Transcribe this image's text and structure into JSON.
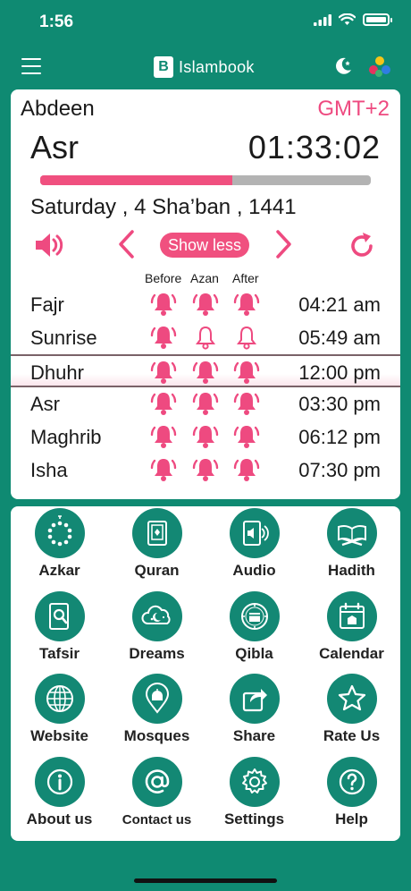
{
  "status": {
    "time": "1:56"
  },
  "nav": {
    "app_name": "Islambook",
    "logo_letter": "B"
  },
  "prayer_card": {
    "location": "Abdeen",
    "timezone": "GMT+2",
    "current_prayer": "Asr",
    "countdown": "01:33:02",
    "progress_fraction": 0.58,
    "date": "Saturday , 4 Sha’ban , 1441",
    "show_less_label": "Show less",
    "columns": {
      "before": "Before",
      "azan": "Azan",
      "after": "After"
    },
    "prayers": [
      {
        "name": "Fajr",
        "time": "04:21 am",
        "before": "on",
        "azan": "on",
        "after": "on"
      },
      {
        "name": "Sunrise",
        "time": "05:49 am",
        "before": "on",
        "azan": "off",
        "after": "off"
      },
      {
        "name": "Dhuhr",
        "time": "12:00 pm",
        "before": "on",
        "azan": "on",
        "after": "on",
        "current": true
      },
      {
        "name": "Asr",
        "time": "03:30 pm",
        "before": "on",
        "azan": "on",
        "after": "on"
      },
      {
        "name": "Maghrib",
        "time": "06:12 pm",
        "before": "on",
        "azan": "on",
        "after": "on"
      },
      {
        "name": "Isha",
        "time": "07:30 pm",
        "before": "on",
        "azan": "on",
        "after": "on"
      }
    ]
  },
  "menu": {
    "items": [
      {
        "label": "Azkar",
        "icon": "beads-icon"
      },
      {
        "label": "Quran",
        "icon": "quran-book-icon"
      },
      {
        "label": "Audio",
        "icon": "audio-book-icon"
      },
      {
        "label": "Hadith",
        "icon": "open-book-stand-icon"
      },
      {
        "label": "Tafsir",
        "icon": "book-search-icon"
      },
      {
        "label": "Dreams",
        "icon": "dream-cloud-icon"
      },
      {
        "label": "Qibla",
        "icon": "kaaba-compass-icon"
      },
      {
        "label": "Calendar",
        "icon": "calendar-icon"
      },
      {
        "label": "Website",
        "icon": "globe-icon"
      },
      {
        "label": "Mosques",
        "icon": "mosque-pin-icon"
      },
      {
        "label": "Share",
        "icon": "share-icon"
      },
      {
        "label": "Rate Us",
        "icon": "star-icon"
      },
      {
        "label": "About us",
        "icon": "info-icon"
      },
      {
        "label": "Contact us",
        "icon": "at-sign-icon"
      },
      {
        "label": "Settings",
        "icon": "gear-icon"
      },
      {
        "label": "Help",
        "icon": "question-icon"
      }
    ]
  },
  "colors": {
    "brand_green": "#0f8a72",
    "accent_pink": "#f0507f",
    "progress_track": "#b3b3b3"
  }
}
